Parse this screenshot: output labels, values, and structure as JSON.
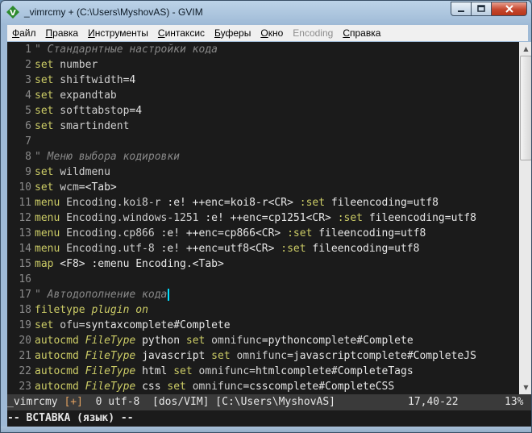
{
  "window": {
    "title": "_vimrcmy + (C:\\Users\\MyshovAS) - GVIM",
    "icon": "vim-icon",
    "controls": [
      "minimize-icon",
      "maximize-icon",
      "close-icon"
    ]
  },
  "menu": [
    {
      "label": "Файл",
      "ul": "Ф",
      "rest": "айл",
      "enabled": true
    },
    {
      "label": "Правка",
      "ul": "П",
      "rest": "равка",
      "enabled": true
    },
    {
      "label": "Инструменты",
      "ul": "И",
      "rest": "нструменты",
      "enabled": true
    },
    {
      "label": "Синтаксис",
      "ul": "С",
      "rest": "интаксис",
      "enabled": true
    },
    {
      "label": "Буферы",
      "ul": "Б",
      "rest": "уферы",
      "enabled": true
    },
    {
      "label": "Окно",
      "ul": "О",
      "rest": "кно",
      "enabled": true
    },
    {
      "label": "Encoding",
      "ul": "",
      "rest": "Encoding",
      "enabled": false
    },
    {
      "label": "Справка",
      "ul": "С",
      "rest": "правка",
      "enabled": true
    }
  ],
  "editor": {
    "lines": [
      {
        "n": "1",
        "tokens": [
          {
            "t": "\" Стандарнтные настройки кода",
            "c": "cmt"
          }
        ]
      },
      {
        "n": "2",
        "tokens": [
          {
            "t": "set",
            "c": "kw"
          },
          {
            "t": " number",
            "c": "opt"
          }
        ]
      },
      {
        "n": "3",
        "tokens": [
          {
            "t": "set",
            "c": "kw"
          },
          {
            "t": " shiftwidth",
            "c": "opt"
          },
          {
            "t": "=4",
            "c": "txt"
          }
        ]
      },
      {
        "n": "4",
        "tokens": [
          {
            "t": "set",
            "c": "kw"
          },
          {
            "t": " expandtab",
            "c": "opt"
          }
        ]
      },
      {
        "n": "5",
        "tokens": [
          {
            "t": "set",
            "c": "kw"
          },
          {
            "t": " softtabstop",
            "c": "opt"
          },
          {
            "t": "=4",
            "c": "txt"
          }
        ]
      },
      {
        "n": "6",
        "tokens": [
          {
            "t": "set",
            "c": "kw"
          },
          {
            "t": " smartindent",
            "c": "opt"
          }
        ]
      },
      {
        "n": "7",
        "tokens": []
      },
      {
        "n": "8",
        "tokens": [
          {
            "t": "\" Меню выбора кодировки",
            "c": "cmt"
          }
        ]
      },
      {
        "n": "9",
        "tokens": [
          {
            "t": "set",
            "c": "kw"
          },
          {
            "t": " wildmenu",
            "c": "opt"
          }
        ]
      },
      {
        "n": "10",
        "tokens": [
          {
            "t": "set",
            "c": "kw"
          },
          {
            "t": " wcm",
            "c": "opt"
          },
          {
            "t": "=<Tab>",
            "c": "txt"
          }
        ]
      },
      {
        "n": "11",
        "tokens": [
          {
            "t": "menu",
            "c": "kw"
          },
          {
            "t": " Encoding.koi8-r ",
            "c": "opt"
          },
          {
            "t": ":e! ++enc=koi8-r<CR> ",
            "c": "txt"
          },
          {
            "t": ":set",
            "c": "kw"
          },
          {
            "t": " fileencoding=utf8",
            "c": "txt"
          }
        ]
      },
      {
        "n": "12",
        "tokens": [
          {
            "t": "menu",
            "c": "kw"
          },
          {
            "t": " Encoding.windows-1251 ",
            "c": "opt"
          },
          {
            "t": ":e! ++enc=cp1251<CR> ",
            "c": "txt"
          },
          {
            "t": ":set",
            "c": "kw"
          },
          {
            "t": " fileencoding=utf8",
            "c": "txt"
          }
        ]
      },
      {
        "n": "13",
        "tokens": [
          {
            "t": "menu",
            "c": "kw"
          },
          {
            "t": " Encoding.cp866 ",
            "c": "opt"
          },
          {
            "t": ":e! ++enc=cp866<CR> ",
            "c": "txt"
          },
          {
            "t": ":set",
            "c": "kw"
          },
          {
            "t": " fileencoding=utf8",
            "c": "txt"
          }
        ]
      },
      {
        "n": "14",
        "tokens": [
          {
            "t": "menu",
            "c": "kw"
          },
          {
            "t": " Encoding.utf-8 ",
            "c": "opt"
          },
          {
            "t": ":e! ++enc=utf8<CR> ",
            "c": "txt"
          },
          {
            "t": ":set",
            "c": "kw"
          },
          {
            "t": " fileencoding=utf8",
            "c": "txt"
          }
        ]
      },
      {
        "n": "15",
        "tokens": [
          {
            "t": "map",
            "c": "kw"
          },
          {
            "t": " <F8> :emenu Encoding.<Tab>",
            "c": "txt"
          }
        ]
      },
      {
        "n": "16",
        "tokens": []
      },
      {
        "n": "17",
        "tokens": [
          {
            "t": "\" Автодополнение кода",
            "c": "cmt"
          }
        ],
        "cursor": true
      },
      {
        "n": "18",
        "tokens": [
          {
            "t": "filetype",
            "c": "kw"
          },
          {
            "t": " plugin on",
            "c": "ty"
          }
        ]
      },
      {
        "n": "19",
        "tokens": [
          {
            "t": "set",
            "c": "kw"
          },
          {
            "t": " ofu",
            "c": "opt"
          },
          {
            "t": "=syntaxcomplete#Complete",
            "c": "txt"
          }
        ]
      },
      {
        "n": "20",
        "tokens": [
          {
            "t": "autocmd",
            "c": "kw"
          },
          {
            "t": " FileType",
            "c": "ty"
          },
          {
            "t": " python ",
            "c": "txt"
          },
          {
            "t": "set",
            "c": "kw"
          },
          {
            "t": " omnifunc",
            "c": "opt"
          },
          {
            "t": "=pythoncomplete#Complete",
            "c": "txt"
          }
        ]
      },
      {
        "n": "21",
        "tokens": [
          {
            "t": "autocmd",
            "c": "kw"
          },
          {
            "t": " FileType",
            "c": "ty"
          },
          {
            "t": " javascript ",
            "c": "txt"
          },
          {
            "t": "set",
            "c": "kw"
          },
          {
            "t": " omnifunc",
            "c": "opt"
          },
          {
            "t": "=javascriptcomplete#CompleteJS",
            "c": "txt"
          }
        ]
      },
      {
        "n": "22",
        "tokens": [
          {
            "t": "autocmd",
            "c": "kw"
          },
          {
            "t": " FileType",
            "c": "ty"
          },
          {
            "t": " html ",
            "c": "txt"
          },
          {
            "t": "set",
            "c": "kw"
          },
          {
            "t": " omnifunc",
            "c": "opt"
          },
          {
            "t": "=htmlcomplete#CompleteTags",
            "c": "txt"
          }
        ]
      },
      {
        "n": "23",
        "tokens": [
          {
            "t": "autocmd",
            "c": "kw"
          },
          {
            "t": " FileType",
            "c": "ty"
          },
          {
            "t": " css ",
            "c": "txt"
          },
          {
            "t": "set",
            "c": "kw"
          },
          {
            "t": " omnifunc",
            "c": "opt"
          },
          {
            "t": "=csscomplete#CompleteCSS",
            "c": "txt"
          }
        ]
      }
    ]
  },
  "statusline": {
    "filename": "_vimrcmy ",
    "modified": "[+]",
    "info": "  0 utf-8  [dos/VIM] [C:\\Users\\MyshovAS]",
    "position": "17,40-22",
    "percent": "13%"
  },
  "cmdline": {
    "text": "-- ВСТАВКА (язык) --"
  },
  "colors": {
    "background": "#1b1b1b",
    "keyword": "#cccc66",
    "comment": "#888888",
    "cursor": "#00e0ff",
    "statusline_bg": "#3a3a3a"
  }
}
